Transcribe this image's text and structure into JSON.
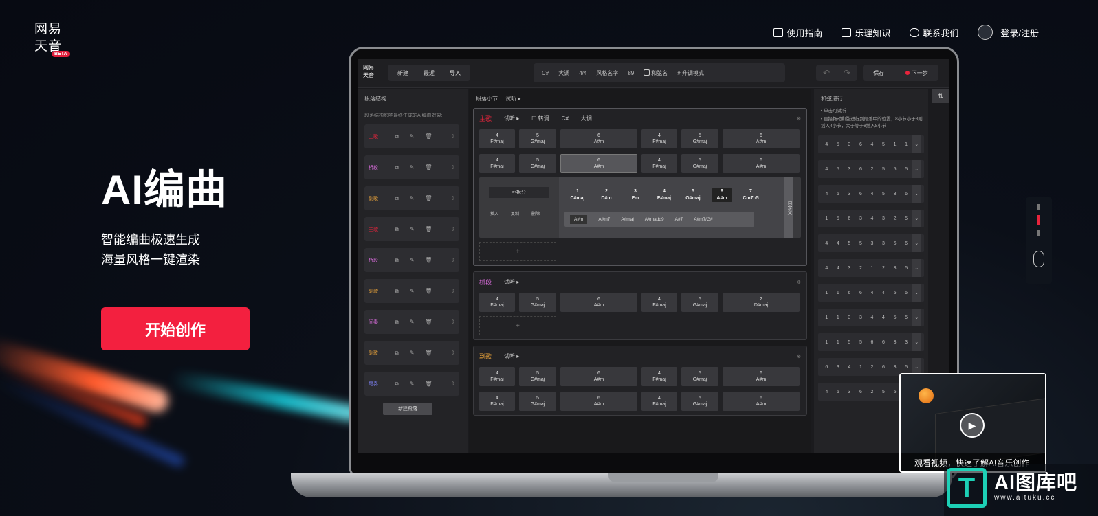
{
  "brand": {
    "logo_line1": "网易",
    "logo_line2": "天音",
    "beta": "BETA"
  },
  "nav": [
    {
      "label": "使用指南",
      "icon": "book-icon"
    },
    {
      "label": "乐理知识",
      "icon": "document-icon"
    },
    {
      "label": "联系我们",
      "icon": "chat-icon"
    },
    {
      "label": "登录/注册",
      "icon": "user-icon"
    }
  ],
  "hero": {
    "title": "AI编曲",
    "sub1": "智能编曲极速生成",
    "sub2": "海量风格一键渲染",
    "cta": "开始创作"
  },
  "app": {
    "logo1": "网易",
    "logo2": "天音",
    "file": {
      "new": "新建",
      "recent": "最近",
      "import": "导入"
    },
    "toolbar": {
      "key": "C#",
      "mode": "大调",
      "meter": "4/4",
      "style": "风格名字",
      "tempo": "89",
      "chord_name": "和弦名",
      "rise": "# 升调模式"
    },
    "save": "保存",
    "next": "下一步",
    "left": {
      "title": "段落结构",
      "hint": "段落结构影响最终生成的AI编曲效果;",
      "new_seg": "新建段落",
      "segments": [
        {
          "name": "主歌",
          "color": "#e8243c"
        },
        {
          "name": "桥段",
          "color": "#d56bd8"
        },
        {
          "name": "副歌",
          "color": "#e8a23a"
        },
        {
          "name": "主歌",
          "color": "#e8243c"
        },
        {
          "name": "桥段",
          "color": "#d56bd8"
        },
        {
          "name": "副歌",
          "color": "#e8a23a"
        },
        {
          "name": "间奏",
          "color": "#d56bd8"
        },
        {
          "name": "副歌",
          "color": "#e8a23a"
        },
        {
          "name": "尾奏",
          "color": "#7a7ef0"
        }
      ]
    },
    "mid": {
      "title": "段落小节",
      "listen": "试听",
      "sec1": {
        "name": "主歌",
        "listen": "试听",
        "mod": "转调",
        "key": "C#",
        "mode": "大调"
      },
      "sec2": {
        "name": "桥段",
        "listen": "试听"
      },
      "sec3": {
        "name": "副歌",
        "listen": "试听"
      },
      "chord_row": [
        {
          "d": "4",
          "c": "F#maj"
        },
        {
          "d": "5",
          "c": "G#maj"
        },
        {
          "d": "6",
          "c": "A#m"
        },
        {
          "d": "4",
          "c": "F#maj"
        },
        {
          "d": "5",
          "c": "G#maj"
        },
        {
          "d": "6",
          "c": "A#m"
        }
      ],
      "bridge_row": [
        {
          "d": "4",
          "c": "F#maj"
        },
        {
          "d": "5",
          "c": "G#maj"
        },
        {
          "d": "6",
          "c": "A#m"
        },
        {
          "d": "4",
          "c": "F#maj"
        },
        {
          "d": "5",
          "c": "G#maj"
        },
        {
          "d": "2",
          "c": "D#maj"
        }
      ],
      "edit": {
        "split": "拆分",
        "insert": "插入",
        "copy": "复制",
        "delete": "删除",
        "custom": "自定义",
        "degrees": [
          {
            "d": "1",
            "c": "C#maj"
          },
          {
            "d": "2",
            "c": "D#m"
          },
          {
            "d": "3",
            "c": "Fm"
          },
          {
            "d": "4",
            "c": "F#maj"
          },
          {
            "d": "5",
            "c": "G#maj"
          },
          {
            "d": "6",
            "c": "A#m"
          },
          {
            "d": "7",
            "c": "Cm7b5"
          }
        ],
        "variants": [
          "A#m",
          "A#m7",
          "A#maj",
          "A#madd9",
          "A#7",
          "A#m7/G#"
        ]
      }
    },
    "right": {
      "title": "和弦进行",
      "tip1": "• 单击可试听",
      "tip2": "• 直接拖动和弦进行到段落中的位置，8小节小于8则插入4小节，大于等于8插入8小节",
      "progs": [
        [
          "4",
          "5",
          "3",
          "6",
          "4",
          "5",
          "1",
          "1"
        ],
        [
          "4",
          "5",
          "3",
          "6",
          "2",
          "5",
          "5",
          "5"
        ],
        [
          "4",
          "5",
          "3",
          "6",
          "4",
          "5",
          "3",
          "6"
        ],
        [
          "1",
          "5",
          "6",
          "3",
          "4",
          "3",
          "2",
          "5"
        ],
        [
          "4",
          "4",
          "5",
          "5",
          "3",
          "3",
          "6",
          "6"
        ],
        [
          "4",
          "4",
          "3",
          "2",
          "1",
          "2",
          "3",
          "5"
        ],
        [
          "1",
          "1",
          "6",
          "6",
          "4",
          "4",
          "5",
          "5"
        ],
        [
          "1",
          "1",
          "3",
          "3",
          "4",
          "4",
          "5",
          "5"
        ],
        [
          "1",
          "1",
          "5",
          "5",
          "6",
          "6",
          "3",
          "3"
        ],
        [
          "6",
          "3",
          "4",
          "1",
          "2",
          "6",
          "3",
          "5"
        ],
        [
          "4",
          "5",
          "3",
          "6",
          "2",
          "5",
          "5",
          "5"
        ]
      ]
    }
  },
  "video": {
    "caption": "观看视频，快速了解AI音乐创作"
  },
  "watermark": {
    "text": "AI图库吧",
    "url": "www.aituku.cc"
  }
}
